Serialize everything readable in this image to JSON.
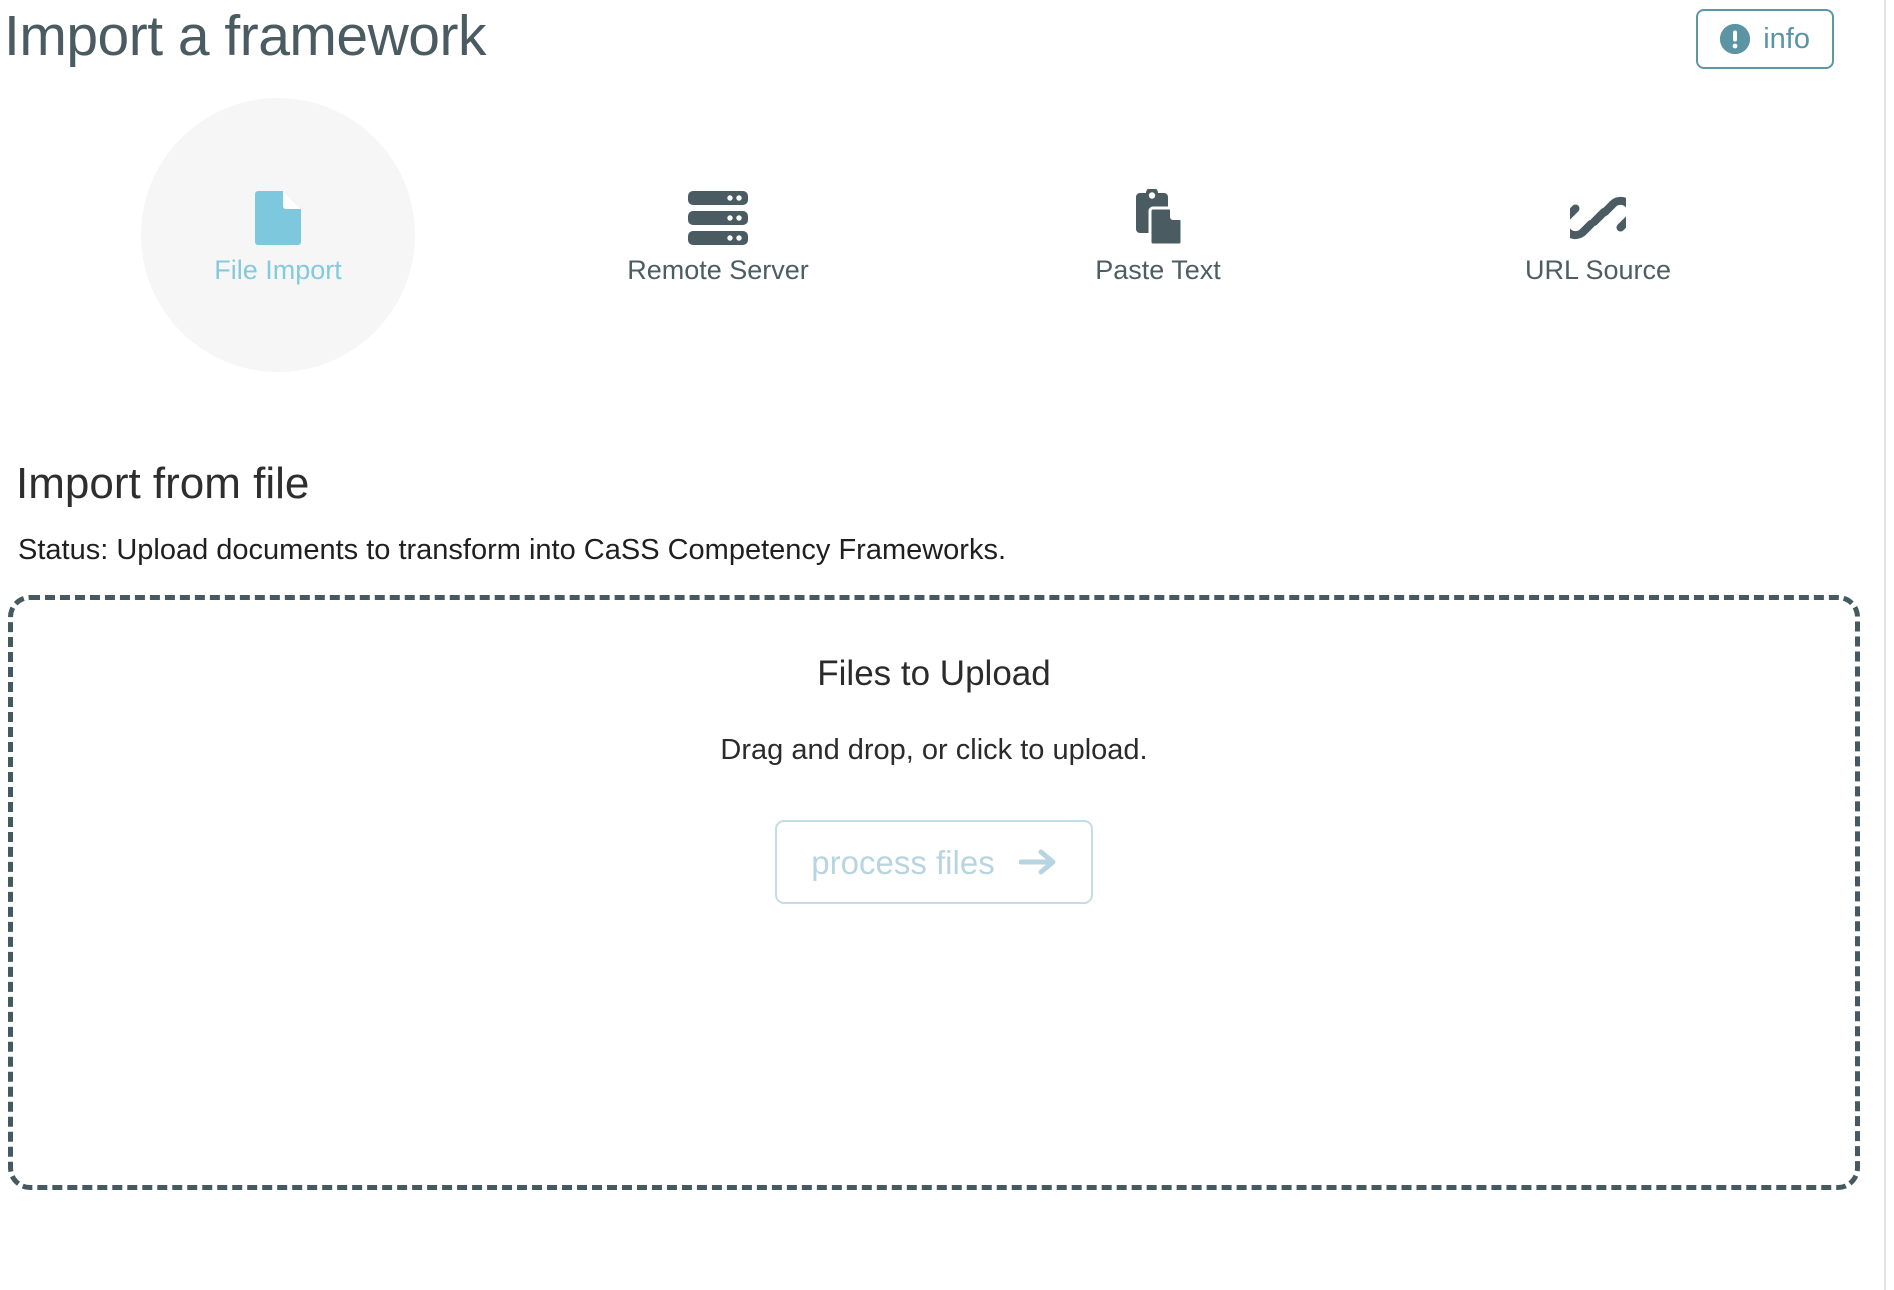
{
  "header": {
    "title": "Import a framework",
    "info_button": {
      "label": "info",
      "icon": "exclamation-circle-icon",
      "color": "#5b94a3"
    }
  },
  "source_tabs": {
    "active_index": 0,
    "active_color": "#85c9dd",
    "inactive_color": "#4c5e63",
    "active_bg": "#f6f6f6",
    "items": [
      {
        "label": "File Import",
        "icon": "file-document-icon",
        "active": true
      },
      {
        "label": "Remote Server",
        "icon": "server-rack-icon",
        "active": false
      },
      {
        "label": "Paste Text",
        "icon": "clipboard-paste-icon",
        "active": false
      },
      {
        "label": "URL Source",
        "icon": "chain-link-icon",
        "active": false
      }
    ]
  },
  "section": {
    "heading": "Import from file",
    "status": "Status: Upload documents to transform into CaSS Competency Frameworks."
  },
  "dropzone": {
    "title": "Files to Upload",
    "subtitle": "Drag and drop, or click to upload.",
    "border_color": "#455a60",
    "process_button": {
      "label": "process files",
      "icon": "arrow-right-icon",
      "color": "#b7d5e0",
      "disabled": true
    }
  }
}
